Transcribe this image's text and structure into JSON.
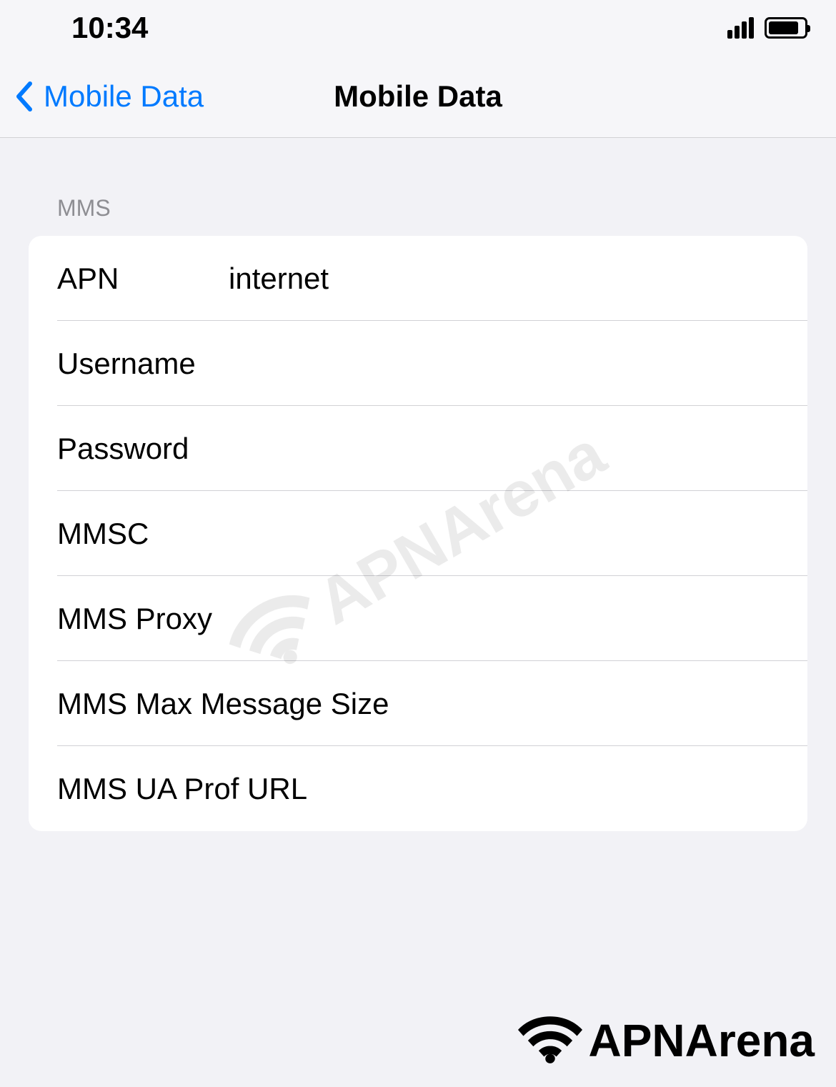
{
  "status_bar": {
    "time": "10:34"
  },
  "nav": {
    "back_label": "Mobile Data",
    "title": "Mobile Data"
  },
  "section": {
    "header": "MMS",
    "rows": [
      {
        "label": "APN",
        "value": "internet"
      },
      {
        "label": "Username",
        "value": ""
      },
      {
        "label": "Password",
        "value": ""
      },
      {
        "label": "MMSC",
        "value": ""
      },
      {
        "label": "MMS Proxy",
        "value": ""
      },
      {
        "label": "MMS Max Message Size",
        "value": ""
      },
      {
        "label": "MMS UA Prof URL",
        "value": ""
      }
    ]
  },
  "watermark": "APNArena",
  "footer_logo": "APNArena"
}
